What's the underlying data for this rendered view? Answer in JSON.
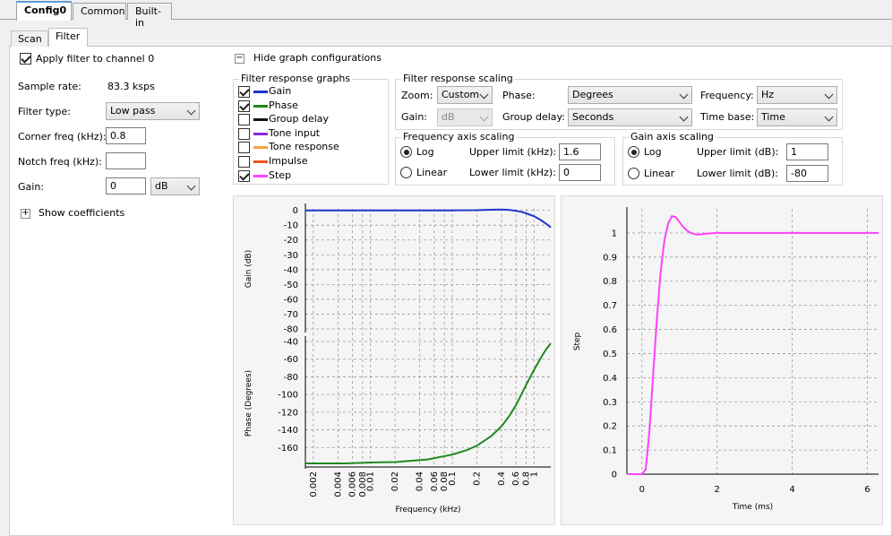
{
  "top_tabs": [
    "Config0",
    "Common",
    "Built-in"
  ],
  "inner_tabs": [
    "Scan",
    "Filter"
  ],
  "apply_filter": {
    "label": "Apply filter to channel 0",
    "checked": true
  },
  "sample_rate": {
    "label": "Sample rate:",
    "value": "83.3 ksps"
  },
  "filter_type": {
    "label": "Filter type:",
    "value": "Low pass"
  },
  "corner_freq": {
    "label": "Corner freq (kHz):",
    "value": "0.8"
  },
  "notch_freq": {
    "label": "Notch freq (kHz):",
    "value": ""
  },
  "gain": {
    "label": "Gain:",
    "value": "0",
    "unit": "dB"
  },
  "show_coefficients": {
    "label": "Show coefficients",
    "symbol": "+"
  },
  "hide_graph_config": {
    "label": "Hide graph configurations",
    "symbol": "−"
  },
  "response_graphs": {
    "title": "Filter response graphs",
    "items": [
      {
        "label": "Gain",
        "checked": true,
        "color": "#1f35c8"
      },
      {
        "label": "Phase",
        "checked": true,
        "color": "#1e8a1e"
      },
      {
        "label": "Group delay",
        "checked": false,
        "color": "#111111"
      },
      {
        "label": "Tone input",
        "checked": false,
        "color": "#8a2be2"
      },
      {
        "label": "Tone response",
        "checked": false,
        "color": "#f4a040"
      },
      {
        "label": "Impulse",
        "checked": false,
        "color": "#f05020"
      },
      {
        "label": "Step",
        "checked": true,
        "color": "#ff40ff"
      }
    ]
  },
  "response_scaling": {
    "title": "Filter response scaling",
    "zoom": {
      "label": "Zoom:",
      "value": "Custom"
    },
    "gain": {
      "label": "Gain:",
      "value": "dB"
    },
    "phase": {
      "label": "Phase:",
      "value": "Degrees"
    },
    "group_delay": {
      "label": "Group delay:",
      "value": "Seconds"
    },
    "frequency": {
      "label": "Frequency:",
      "value": "Hz"
    },
    "time_base": {
      "label": "Time base:",
      "value": "Time"
    }
  },
  "freq_axis": {
    "title": "Frequency axis scaling",
    "log_label": "Log",
    "linear_label": "Linear",
    "selected": "Log",
    "upper_label": "Upper limit (kHz):",
    "upper_value": "1.6",
    "lower_label": "Lower limit (kHz):",
    "lower_value": "0"
  },
  "gain_axis": {
    "title": "Gain axis scaling",
    "log_label": "Log",
    "linear_label": "Linear",
    "selected": "Log",
    "upper_label": "Upper limit (dB):",
    "upper_value": "1",
    "lower_label": "Lower limit (dB):",
    "lower_value": "-80"
  },
  "chart_data": [
    {
      "type": "line",
      "x_scale": "log",
      "xlabel": "Frequency (kHz)",
      "x_ticks": [
        "0.002",
        "0.004",
        "0.006",
        "0.008",
        "0.01",
        "0.02",
        "0.04",
        "0.06",
        "0.08",
        "0.1",
        "0.2",
        "0.4",
        "0.6",
        "0.8",
        "1"
      ],
      "xlim": [
        0.0016,
        1.6
      ],
      "grid": true,
      "panels": [
        {
          "ylabel": "Gain (dB)",
          "y_ticks": [
            "0",
            "-10",
            "-20",
            "-30",
            "-40",
            "-50",
            "-60",
            "-70",
            "-80"
          ],
          "ylim": [
            -80,
            1
          ],
          "series": [
            {
              "name": "Gain",
              "color": "#1f35c8",
              "x": [
                0.0016,
                0.01,
                0.1,
                0.2,
                0.3,
                0.4,
                0.5,
                0.6,
                0.7,
                0.8,
                1.0,
                1.2,
                1.4,
                1.6
              ],
              "y": [
                0,
                0,
                0,
                0.1,
                0.4,
                0.5,
                0.2,
                -0.3,
                -1.0,
                -2.0,
                -4.0,
                -6.5,
                -9.0,
                -11.5
              ]
            }
          ]
        },
        {
          "ylabel": "Phase (Degrees)",
          "y_ticks": [
            "-40",
            "-60",
            "-80",
            "-100",
            "-120",
            "-140",
            "-160"
          ],
          "ylim": [
            -180,
            -40
          ],
          "series": [
            {
              "name": "Phase",
              "color": "#1e8a1e",
              "x": [
                0.0016,
                0.005,
                0.01,
                0.02,
                0.05,
                0.1,
                0.15,
                0.2,
                0.3,
                0.4,
                0.5,
                0.6,
                0.7,
                0.8,
                1.0,
                1.2,
                1.4,
                1.6
              ],
              "y": [
                -178,
                -178,
                -177,
                -176.5,
                -173.5,
                -168,
                -163,
                -158,
                -147,
                -136,
                -124,
                -112,
                -100,
                -89,
                -72,
                -59,
                -49,
                -42
              ]
            }
          ]
        }
      ]
    },
    {
      "type": "line",
      "xlabel": "Time (ms)",
      "ylabel": "Step",
      "x_ticks": [
        "0",
        "2",
        "4",
        "6"
      ],
      "y_ticks": [
        "0",
        "0.1",
        "0.2",
        "0.3",
        "0.4",
        "0.5",
        "0.6",
        "0.7",
        "0.8",
        "0.9",
        "1"
      ],
      "xlim": [
        -0.4,
        6.3
      ],
      "ylim": [
        0,
        1.1
      ],
      "grid": true,
      "series": [
        {
          "name": "Step",
          "color": "#ff40ff",
          "x": [
            -0.4,
            0.0,
            0.1,
            0.2,
            0.3,
            0.4,
            0.5,
            0.6,
            0.7,
            0.8,
            0.9,
            1.0,
            1.1,
            1.2,
            1.3,
            1.4,
            1.5,
            1.6,
            1.8,
            2.0,
            3.0,
            4.0,
            5.0,
            6.3
          ],
          "y": [
            0,
            0,
            0.02,
            0.18,
            0.42,
            0.65,
            0.84,
            0.97,
            1.04,
            1.07,
            1.065,
            1.045,
            1.025,
            1.01,
            1.0,
            0.995,
            0.993,
            0.995,
            0.998,
            1.0,
            1.0,
            1.0,
            1.0,
            1.0
          ]
        }
      ]
    }
  ]
}
